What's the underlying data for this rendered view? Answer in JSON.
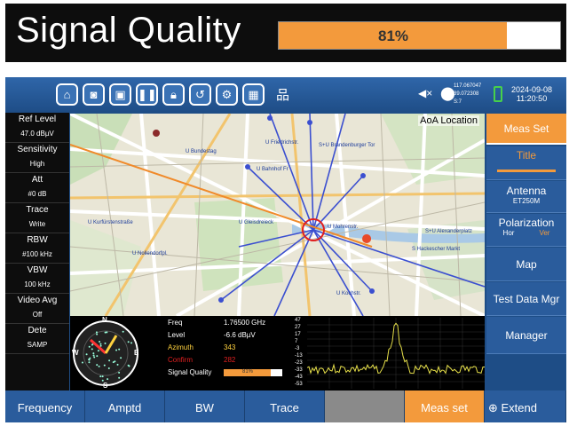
{
  "banner": {
    "title": "Signal Quality",
    "value_label": "81%",
    "value": 81,
    "fill_color": "#f39a3c"
  },
  "topbar": {
    "icons": [
      "home-icon",
      "camera-icon",
      "video-icon",
      "pause-icon",
      "lock-icon",
      "undo-icon",
      "gear-icon",
      "grid-icon",
      "network-icon"
    ],
    "gps": {
      "line1": "117.067047",
      "line2": "39.072308",
      "line3": "S:7"
    },
    "date": "2024-09-08",
    "time": "11:20:50"
  },
  "left_panel": [
    {
      "label": "Ref Level",
      "value": "47.0 dBµV"
    },
    {
      "label": "Sensitivity",
      "value": "High"
    },
    {
      "label": "Att",
      "value": "#0 dB"
    },
    {
      "label": "Trace",
      "value": "Write"
    },
    {
      "label": "RBW",
      "value": "#100 kHz"
    },
    {
      "label": "VBW",
      "value": "100 kHz"
    },
    {
      "label": "Video Avg",
      "value": "Off"
    },
    {
      "label": "Dete",
      "value": "SAMP"
    }
  ],
  "map": {
    "title": "AoA Location",
    "streets": [
      "U Bahnhof Fr",
      "U Friedrichstr.",
      "S+U Brandenburger Tor",
      "U Kochstr.",
      "U Bundestag",
      "S Hackescher Markt",
      "U Mohrenstr.",
      "U Gleisdreieck",
      "U Kurfürstenstraße",
      "U Nollendorfpl.",
      "S+U Alexanderplatz"
    ]
  },
  "right_menu": [
    {
      "label": "Meas Set",
      "active": true
    },
    {
      "label": "Title",
      "sub": ""
    },
    {
      "label": "Antenna",
      "sub": "ET250M"
    },
    {
      "label": "Polarization",
      "sub_left": "Hor",
      "sub_right": "Ver"
    },
    {
      "label": "Map"
    },
    {
      "label": "Test Data Mgr"
    },
    {
      "label": "Manager"
    }
  ],
  "info": {
    "freq_label": "Freq",
    "freq_value": "1.76500 GHz",
    "level_label": "Level",
    "level_value": "-6.6 dBµV",
    "azimuth_label": "Azimuth",
    "azimuth_value": "343",
    "confirm_label": "Confirm",
    "confirm_value": "282",
    "sq_label": "Signal Quality",
    "sq_value_label": "81%",
    "sq_value": 81
  },
  "compass": {
    "n": "N",
    "s": "S",
    "e": "E",
    "w": "W",
    "needle_deg": 343
  },
  "spectrum_ticks": [
    "47",
    "27",
    "17",
    "7",
    "-3",
    "-13",
    "-23",
    "-33",
    "-43",
    "-53"
  ],
  "bottom_menu": [
    "Frequency",
    "Amptd",
    "BW",
    "Trace",
    "",
    "Meas set",
    "Extend"
  ],
  "colors": {
    "accent": "#f39a3c",
    "panel": "#1e4d86",
    "trace": "#e7e04a"
  }
}
